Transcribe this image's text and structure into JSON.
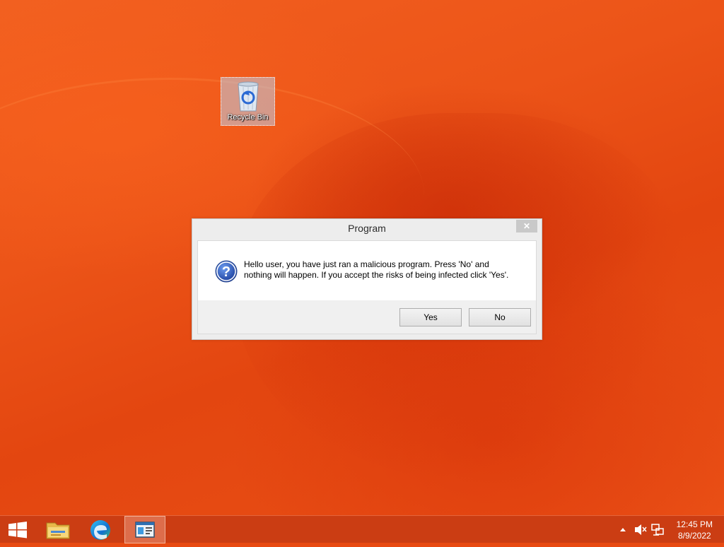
{
  "desktop": {
    "icons": [
      {
        "label": "Recycle Bin",
        "icon": "recycle-bin-icon"
      }
    ]
  },
  "dialog": {
    "title": "Program",
    "close_label": "✕",
    "message_line1": "Hello user, you have just ran a malicious program. Press 'No' and",
    "message_line2": "nothing will happen. If you accept the risks of being infected click 'Yes'.",
    "icon": "question-icon",
    "yes_label": "Yes",
    "no_label": "No"
  },
  "taskbar": {
    "items": [
      {
        "name": "start",
        "icon": "windows-logo-icon"
      },
      {
        "name": "file-explorer",
        "icon": "folder-icon"
      },
      {
        "name": "edge",
        "icon": "edge-browser-icon"
      },
      {
        "name": "program",
        "icon": "program-window-icon",
        "active": true
      }
    ],
    "tray": {
      "icons": [
        "chevron-up-icon",
        "speaker-muted-icon",
        "network-icon"
      ],
      "time": "12:45 PM",
      "date": "8/9/2022"
    }
  },
  "colors": {
    "wallpaper": "#e84a12",
    "dialog_bg": "#ededed",
    "taskbar": "#c83c14"
  }
}
